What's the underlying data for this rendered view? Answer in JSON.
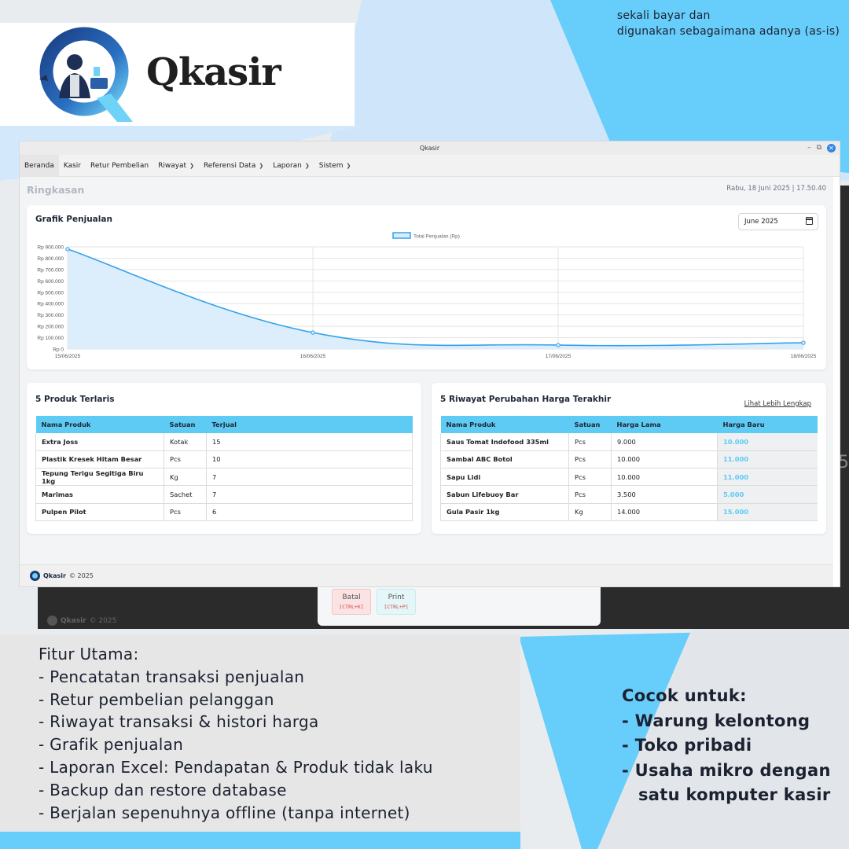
{
  "poster": {
    "brand": "Qkasir",
    "note_line1": "sekali bayar dan",
    "note_line2": "digunakan sebagaimana adanya (as-is)"
  },
  "window": {
    "title": "Qkasir",
    "menu": [
      {
        "label": "Beranda",
        "dropdown": false
      },
      {
        "label": "Kasir",
        "dropdown": false
      },
      {
        "label": "Retur Pembelian",
        "dropdown": false
      },
      {
        "label": "Riwayat",
        "dropdown": true
      },
      {
        "label": "Referensi Data",
        "dropdown": true
      },
      {
        "label": "Laporan",
        "dropdown": true
      },
      {
        "label": "Sistem",
        "dropdown": true
      }
    ]
  },
  "page": {
    "title": "Ringkasan",
    "datetime": "Rabu, 18 Juni 2025 | 17.50.40"
  },
  "sales_chart": {
    "heading": "Grafik Penjualan",
    "month_value": "June 2025"
  },
  "chart_data": {
    "type": "area",
    "legend": "Total Penjualan (Rp)",
    "legend_position": "top-center",
    "x": [
      "15/06/2025",
      "16/06/2025",
      "17/06/2025",
      "18/06/2025"
    ],
    "series": [
      {
        "name": "Total Penjualan (Rp)",
        "values": [
          880000,
          145000,
          35000,
          55000
        ]
      }
    ],
    "ylim": [
      0,
      900000
    ],
    "y_ticks": [
      "Rp 0",
      "Rp 100.000",
      "Rp 200.000",
      "Rp 300.000",
      "Rp 400.000",
      "Rp 500.000",
      "Rp 600.000",
      "Rp 700.000",
      "Rp 800.000",
      "Rp 900.000"
    ],
    "grid": true,
    "line_color": "#36a2eb",
    "fill_color": "#d8ecfb"
  },
  "top_products": {
    "heading": "5 Produk Terlaris",
    "columns": [
      "Nama Produk",
      "Satuan",
      "Terjual"
    ],
    "rows": [
      [
        "Extra Joss",
        "Kotak",
        "15"
      ],
      [
        "Plastik Kresek Hitam Besar",
        "Pcs",
        "10"
      ],
      [
        "Tepung Terigu Segitiga Biru 1kg",
        "Kg",
        "7"
      ],
      [
        "Marimas",
        "Sachet",
        "7"
      ],
      [
        "Pulpen Pilot",
        "Pcs",
        "6"
      ]
    ]
  },
  "price_history": {
    "heading": "5 Riwayat Perubahan Harga Terakhir",
    "more_link": "Lihat Lebih Lengkap",
    "columns": [
      "Nama Produk",
      "Satuan",
      "Harga Lama",
      "Harga Baru"
    ],
    "rows": [
      [
        "Saus Tomat Indofood 335ml",
        "Pcs",
        "9.000",
        "10.000"
      ],
      [
        "Sambal ABC Botol",
        "Pcs",
        "10.000",
        "11.000"
      ],
      [
        "Sapu Lidi",
        "Pcs",
        "10.000",
        "11.000"
      ],
      [
        "Sabun Lifebuoy Bar",
        "Pcs",
        "3.500",
        "5.000"
      ],
      [
        "Gula Pasir 1kg",
        "Kg",
        "14.000",
        "15.000"
      ]
    ]
  },
  "footer": {
    "brand": "Qkasir",
    "copyright": "© 2025"
  },
  "popup": {
    "cancel_label": "Batal",
    "cancel_shortcut": "[CTRL+K]",
    "print_label": "Print",
    "print_shortcut": "[CTRL+P]"
  },
  "features": {
    "heading": "Fitur Utama:",
    "items": [
      "- Pencatatan transaksi penjualan",
      "- Retur pembelian pelanggan",
      "- Riwayat transaksi & histori harga",
      "- Grafik penjualan",
      "- Laporan Excel: Pendapatan & Produk tidak laku",
      "- Backup dan restore database",
      "- Berjalan sepenuhnya offline (tanpa internet)"
    ]
  },
  "suitable": {
    "heading": "Cocok untuk:",
    "item1": "- Warung kelontong",
    "item2": "- Toko pribadi",
    "item3_line1": "- Usaha mikro dengan",
    "item3_line2": "satu komputer kasir"
  }
}
